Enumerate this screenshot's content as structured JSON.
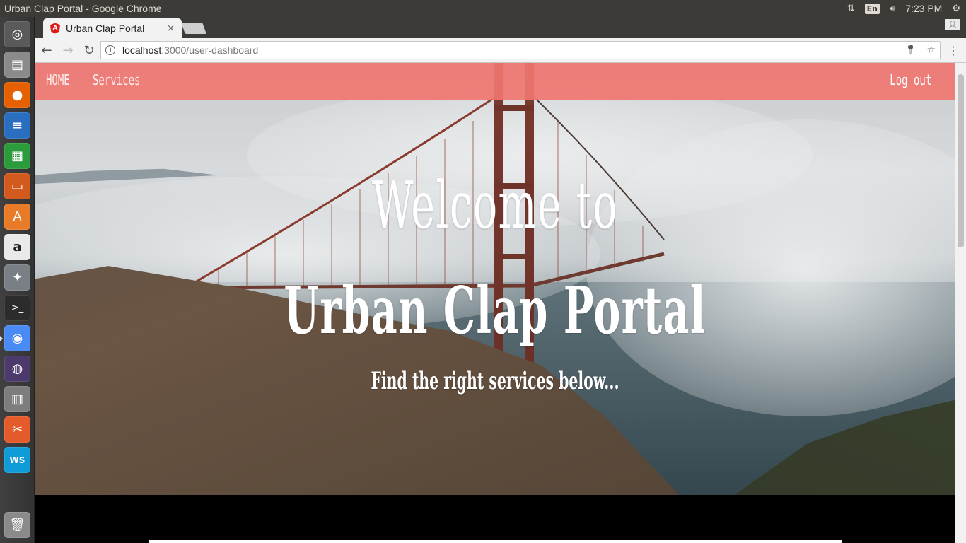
{
  "window": {
    "title": "Urban Clap Portal - Google Chrome"
  },
  "tray": {
    "network_icon": "up-down-arrows",
    "lang": "En",
    "volume_icon": "speaker",
    "time": "7:23 PM",
    "settings_icon": "gear"
  },
  "launcher": {
    "items": [
      "ubuntu-dash",
      "files",
      "firefox",
      "writer",
      "calc",
      "impress",
      "software-center",
      "amazon",
      "system-settings",
      "terminal",
      "chrome",
      "eclipse",
      "workspaces",
      "app-unknown",
      "webstorm",
      "trash"
    ]
  },
  "browser": {
    "tab_title": "Urban Clap Portal",
    "tab_close": "×",
    "url_host": "localhost",
    "url_path": ":3000/user-dashboard",
    "back": "←",
    "forward": "→",
    "reload": "↻",
    "menu": "⋮",
    "star": "☆"
  },
  "nav": {
    "home": "HOME",
    "services": "Services",
    "logout": "Log out"
  },
  "hero": {
    "line1": "Welcome to",
    "line2": "Urban Clap Portal",
    "tagline": "Find the right services below..."
  },
  "colors": {
    "navbar": "#f07670",
    "panel": "#3c3b37"
  }
}
